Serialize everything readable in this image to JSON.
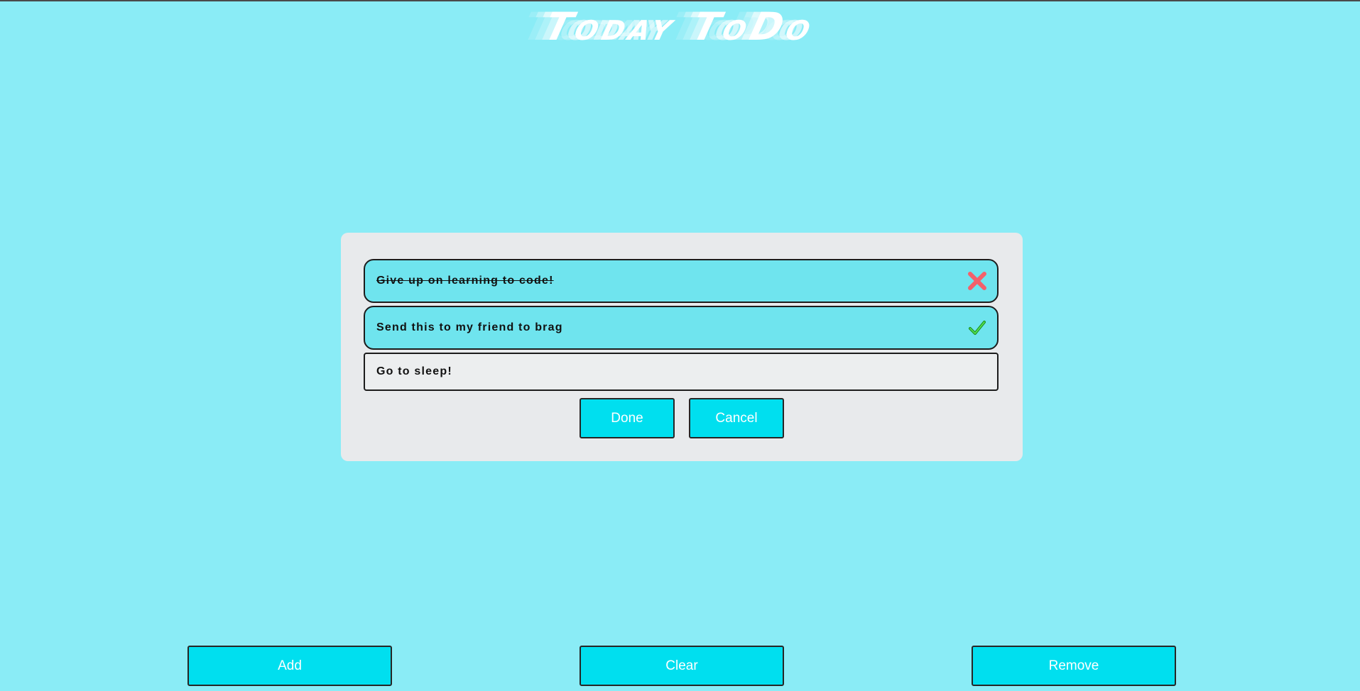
{
  "app": {
    "title": "Today ToDo"
  },
  "modal": {
    "items": [
      {
        "text": "Give up on learning to code!",
        "state": "struck",
        "status_icon": "close-x-icon"
      },
      {
        "text": "Send this to my friend to brag",
        "state": "checked",
        "status_icon": "checkmark-icon"
      },
      {
        "text": "Go to sleep!",
        "state": "editing"
      }
    ],
    "done_label": "Done",
    "cancel_label": "Cancel"
  },
  "footer": {
    "add_label": "Add",
    "clear_label": "Clear",
    "remove_label": "Remove"
  },
  "colors": {
    "background": "#8aecf6",
    "modal_background": "#e8eaec",
    "item_background": "#6fe4ee",
    "button": "#00dfef",
    "remove_icon": "#f4606a",
    "check_icon": "#1fb51f"
  }
}
